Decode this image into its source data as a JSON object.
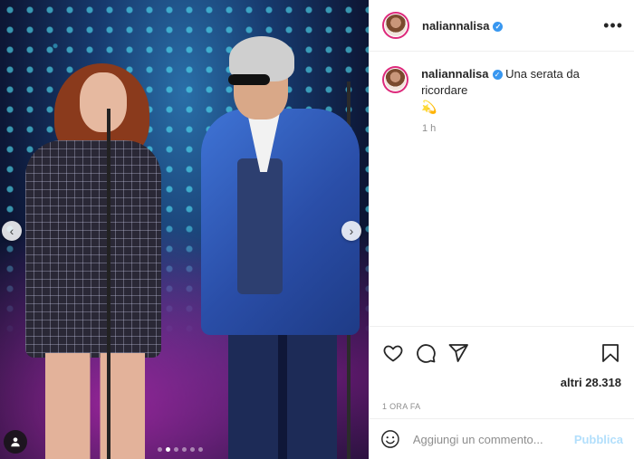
{
  "media": {
    "prev_label": "‹",
    "next_label": "›",
    "carousel_count": 6,
    "carousel_active": 1
  },
  "header": {
    "username": "naliannalisa",
    "verified_mark": "✓",
    "more_label": "•••"
  },
  "caption": {
    "username": "naliannalisa",
    "verified_mark": "✓",
    "text": "Una serata da ricordare",
    "emoji": "💫",
    "time": "1 h"
  },
  "actions": {
    "icons": [
      "heart-icon",
      "comment-icon",
      "share-icon",
      "bookmark-icon"
    ]
  },
  "likes": "altri 28.318",
  "timestamp": "1 ORA FA",
  "comment": {
    "placeholder": "Aggiungi un commento...",
    "publish_label": "Pubblica"
  },
  "colors": {
    "verified": "#3897f0",
    "publish_disabled": "#b2dffc",
    "ring": "#dd2a7b"
  }
}
